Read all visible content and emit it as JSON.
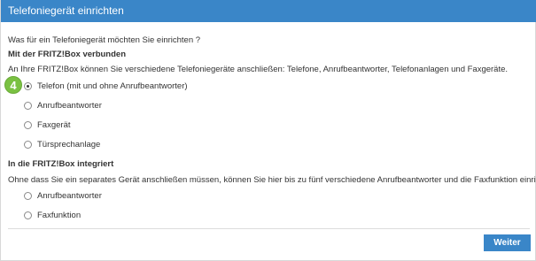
{
  "dialog": {
    "title": "Telefoniegerät einrichten"
  },
  "question": "Was für ein Telefoniegerät möchten Sie einrichten ?",
  "step_badge": "4",
  "connected": {
    "heading": "Mit der FRITZ!Box verbunden",
    "description": "An Ihre FRITZ!Box können Sie verschiedene Telefoniegeräte anschließen: Telefone, Anrufbeantworter, Telefonanlagen und Faxgeräte.",
    "options": [
      {
        "label": "Telefon (mit und ohne Anrufbeantworter)",
        "checked": true
      },
      {
        "label": "Anrufbeantworter",
        "checked": false
      },
      {
        "label": "Faxgerät",
        "checked": false
      },
      {
        "label": "Türsprechanlage",
        "checked": false
      }
    ]
  },
  "integrated": {
    "heading": "In die FRITZ!Box integriert",
    "description": "Ohne dass Sie ein separates Gerät anschließen müssen, können Sie hier bis zu fünf verschiedene Anrufbeantworter und die Faxfunktion einrichten.",
    "options": [
      {
        "label": "Anrufbeantworter",
        "checked": false
      },
      {
        "label": "Faxfunktion",
        "checked": false
      }
    ]
  },
  "footer": {
    "next_label": "Weiter"
  },
  "colors": {
    "accent": "#3a86c8",
    "badge": "#7ac142"
  }
}
